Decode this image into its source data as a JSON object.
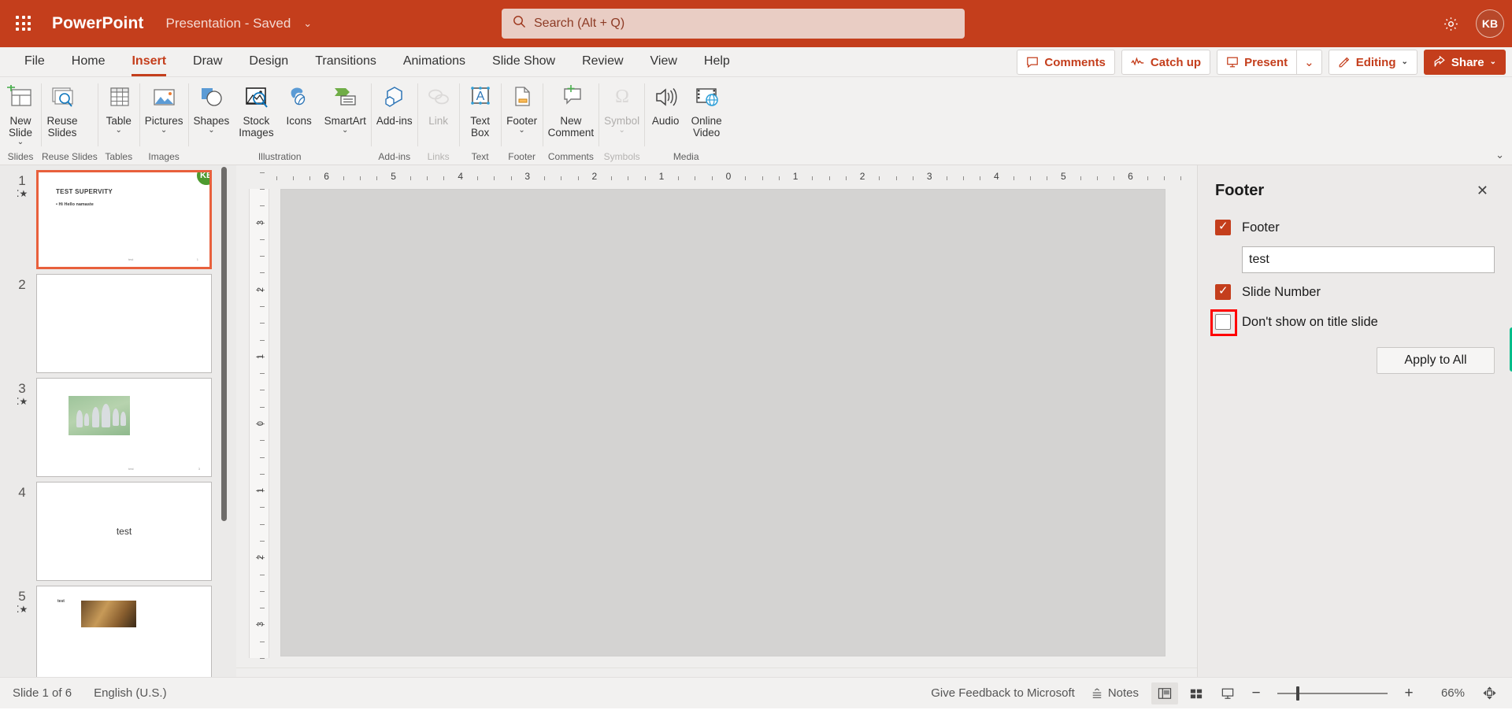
{
  "titlebar": {
    "app_name": "PowerPoint",
    "doc_title": "Presentation  -  Saved",
    "doc_chevron": "⌄",
    "search_placeholder": "Search (Alt + Q)",
    "settings_icon": "gear-icon",
    "avatar_initials": "KB"
  },
  "tabs": [
    {
      "label": "File",
      "active": false
    },
    {
      "label": "Home",
      "active": false
    },
    {
      "label": "Insert",
      "active": true
    },
    {
      "label": "Draw",
      "active": false
    },
    {
      "label": "Design",
      "active": false
    },
    {
      "label": "Transitions",
      "active": false
    },
    {
      "label": "Animations",
      "active": false
    },
    {
      "label": "Slide Show",
      "active": false
    },
    {
      "label": "Review",
      "active": false
    },
    {
      "label": "View",
      "active": false
    },
    {
      "label": "Help",
      "active": false
    }
  ],
  "tabstrip_buttons": {
    "comments": "Comments",
    "catch_up": "Catch up",
    "present": "Present",
    "present_arrow": "⌄",
    "editing": "Editing",
    "editing_arrow": "⌄",
    "share": "Share",
    "share_arrow": "⌄"
  },
  "ribbon": {
    "collapse_icon": "⌄",
    "groups": [
      {
        "label": "Slides",
        "dim": false,
        "items": [
          {
            "label": "New\nSlide",
            "icon": "new-slide-icon",
            "chevron": true
          }
        ]
      },
      {
        "label": "Reuse Slides",
        "dim": false,
        "items": [
          {
            "label": "Reuse\nSlides",
            "icon": "reuse-slides-icon",
            "chevron": false
          }
        ]
      },
      {
        "label": "Tables",
        "dim": false,
        "items": [
          {
            "label": "Table",
            "icon": "table-icon",
            "chevron": true
          }
        ]
      },
      {
        "label": "Images",
        "dim": false,
        "items": [
          {
            "label": "Pictures",
            "icon": "pictures-icon",
            "chevron": true
          }
        ]
      },
      {
        "label": "Illustration",
        "dim": false,
        "items": [
          {
            "label": "Shapes",
            "icon": "shapes-icon",
            "chevron": true
          },
          {
            "label": "Stock\nImages",
            "icon": "stock-images-icon",
            "chevron": false
          },
          {
            "label": "Icons",
            "icon": "icons-icon",
            "chevron": false
          },
          {
            "label": "SmartArt",
            "icon": "smartart-icon",
            "chevron": true
          }
        ]
      },
      {
        "label": "Add-ins",
        "dim": false,
        "items": [
          {
            "label": "Add-ins",
            "icon": "addins-icon",
            "chevron": false
          }
        ]
      },
      {
        "label": "Links",
        "dim": true,
        "items": [
          {
            "label": "Link",
            "icon": "link-icon",
            "chevron": false
          }
        ]
      },
      {
        "label": "Text",
        "dim": false,
        "items": [
          {
            "label": "Text\nBox",
            "icon": "text-box-icon",
            "chevron": false
          }
        ]
      },
      {
        "label": "Footer",
        "dim": false,
        "items": [
          {
            "label": "Footer",
            "icon": "footer-icon",
            "chevron": true
          }
        ]
      },
      {
        "label": "Comments",
        "dim": false,
        "items": [
          {
            "label": "New\nComment",
            "icon": "new-comment-icon",
            "chevron": false
          }
        ]
      },
      {
        "label": "Symbols",
        "dim": true,
        "items": [
          {
            "label": "Symbol",
            "icon": "symbol-icon",
            "chevron": true
          }
        ]
      },
      {
        "label": "Media",
        "dim": false,
        "items": [
          {
            "label": "Audio",
            "icon": "audio-icon",
            "chevron": false
          },
          {
            "label": "Online\nVideo",
            "icon": "online-video-icon",
            "chevron": false
          }
        ]
      }
    ]
  },
  "thumbnails": [
    {
      "number": "1",
      "selected": true,
      "star": true,
      "title": "TEST SUPERVITY",
      "bullet": "• Hi Hello namaste",
      "footer": "test",
      "pagenum": "1",
      "kind": "title",
      "avatar": "KB"
    },
    {
      "number": "2",
      "selected": false,
      "star": false,
      "kind": "blank"
    },
    {
      "number": "3",
      "selected": false,
      "star": true,
      "footer": "test",
      "pagenum": "3",
      "kind": "image-people"
    },
    {
      "number": "4",
      "selected": false,
      "star": false,
      "center_text": "test",
      "kind": "text"
    },
    {
      "number": "5",
      "selected": false,
      "star": true,
      "small_title": "test",
      "kind": "image-rocks"
    }
  ],
  "ruler": {
    "horizontal_labels": [
      "6",
      "5",
      "4",
      "3",
      "2",
      "1",
      "0",
      "1",
      "2",
      "3",
      "4",
      "5",
      "6"
    ],
    "vertical_labels": [
      "3",
      "2",
      "1",
      "0",
      "1",
      "2",
      "3"
    ]
  },
  "footer_pane": {
    "title": "Footer",
    "close_icon": "✕",
    "footer_checkbox": {
      "label": "Footer",
      "checked": true
    },
    "footer_text_value": "test",
    "slide_number_checkbox": {
      "label": "Slide Number",
      "checked": true
    },
    "dont_show_checkbox": {
      "label": "Don't show on title slide",
      "checked": false
    },
    "apply_button": "Apply to All",
    "highlight_color": "#ff0000",
    "accent_color": "#c43e1c"
  },
  "statusbar": {
    "slide_count": "Slide 1 of 6",
    "language": "English (U.S.)",
    "feedback": "Give Feedback to Microsoft",
    "notes": "Notes",
    "view_normal": "normal-view-icon",
    "view_sorter": "slide-sorter-icon",
    "view_reading": "reading-view-icon",
    "zoom_out": "−",
    "zoom_in": "+",
    "zoom_value": "66%",
    "fit_icon": "fit-slide-icon"
  }
}
